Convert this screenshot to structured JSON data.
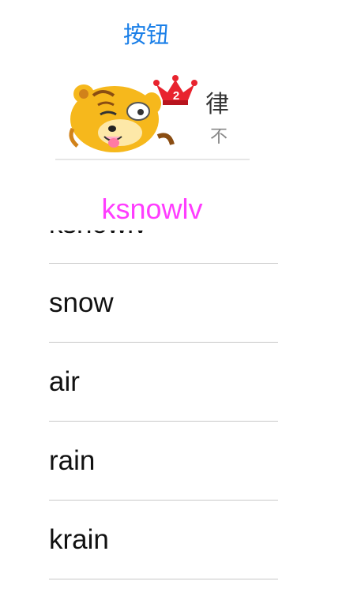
{
  "top_button": {
    "label": "按钮"
  },
  "banner": {
    "crown_number": "2",
    "main_text": "律",
    "sub_text": "不"
  },
  "title_label": "ksnowlv",
  "list": {
    "items": [
      {
        "label": "ksnowlv"
      },
      {
        "label": "snow"
      },
      {
        "label": "air"
      },
      {
        "label": "rain"
      },
      {
        "label": "krain"
      }
    ]
  },
  "colors": {
    "button_blue": "#1a7fe8",
    "label_pink": "#ff3dff",
    "separator": "#c8c8c8"
  }
}
